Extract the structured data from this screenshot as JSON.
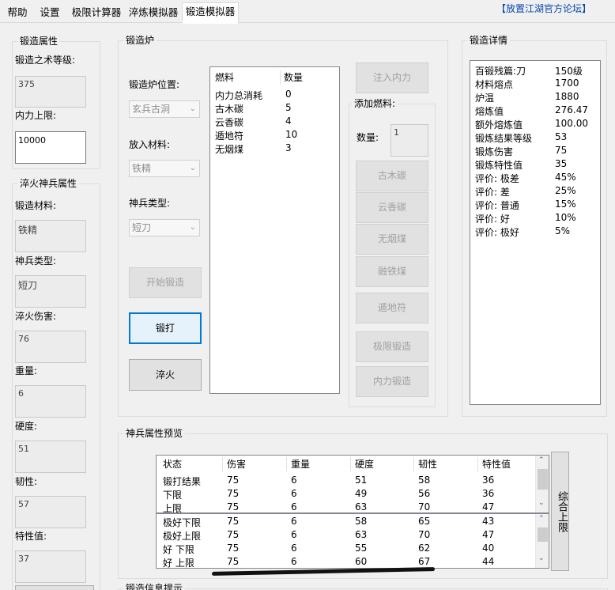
{
  "tabs": [
    "帮助",
    "设置",
    "极限计算器",
    "淬炼模拟器",
    "锻造模拟器"
  ],
  "forum_link": "【放置江湖官方论坛】",
  "forge_attr": {
    "title": "锻造属性",
    "level_label": "锻造之术等级:",
    "level_value": "375",
    "neili_label": "内力上限:",
    "neili_value": "10000"
  },
  "temper_attr": {
    "title": "淬火神兵属性",
    "material_label": "锻造材料:",
    "material_value": "铁精",
    "type_label": "神兵类型:",
    "type_value": "短刀",
    "damage_label": "淬火伤害:",
    "damage_value": "76",
    "weight_label": "重量:",
    "weight_value": "6",
    "hardness_label": "硬度:",
    "hardness_value": "51",
    "toughness_label": "韧性:",
    "toughness_value": "57",
    "trait_label": "特性值:",
    "trait_value": "37"
  },
  "furnace": {
    "title": "锻造炉",
    "location_label": "锻造炉位置:",
    "location_value": "玄兵古洞",
    "material_label": "放入材料:",
    "material_value": "铁精",
    "weapon_label": "神兵类型:",
    "weapon_value": "短刀",
    "start_button": "开始锻造",
    "forge_button": "锻打",
    "temper_button": "淬火",
    "fuel_headers": [
      "燃料",
      "数量"
    ],
    "fuel_rows": [
      [
        "内力总消耗",
        "0"
      ],
      [
        "古木碳",
        "5"
      ],
      [
        "云香碳",
        "4"
      ],
      [
        "遁地符",
        "10"
      ],
      [
        "无烟煤",
        "3"
      ]
    ],
    "inject_button": "注入内力",
    "add_fuel_title": "添加燃料:",
    "qty_label": "数量:",
    "qty_value": "1",
    "fuel_buttons": [
      "古木碳",
      "云香碳",
      "无烟煤",
      "融铁煤",
      "遁地符",
      "极限锻造",
      "内力锻造"
    ]
  },
  "details": {
    "title": "锻造详情",
    "rows": [
      [
        "百锻残篇:刀",
        "150级"
      ],
      [
        "材料熔点",
        "1700"
      ],
      [
        "炉温",
        "1880"
      ],
      [
        "熔炼值",
        "276.47"
      ],
      [
        "额外熔炼值",
        "100.00"
      ],
      [
        "锻炼结果等级",
        "53"
      ],
      [
        "锻炼伤害",
        "75"
      ],
      [
        "锻炼特性值",
        "35"
      ],
      [
        "评价: 极差",
        "45%"
      ],
      [
        "评价:  差",
        "25%"
      ],
      [
        "评价: 普通",
        "15%"
      ],
      [
        "评价:  好",
        "10%"
      ],
      [
        "评价: 极好",
        "5%"
      ]
    ]
  },
  "preview": {
    "title": "神兵属性预览",
    "headers": [
      "状态",
      "伤害",
      "重量",
      "硬度",
      "韧性",
      "特性值"
    ],
    "top_rows": [
      [
        "锻打结果",
        "75",
        "6",
        "51",
        "58",
        "36"
      ],
      [
        "下限",
        "75",
        "6",
        "49",
        "56",
        "36"
      ],
      [
        "上限",
        "75",
        "6",
        "63",
        "70",
        "47"
      ]
    ],
    "bottom_rows": [
      [
        "极好下限",
        "75",
        "6",
        "58",
        "65",
        "43"
      ],
      [
        "极好上限",
        "75",
        "6",
        "63",
        "70",
        "47"
      ],
      [
        "好 下限",
        "75",
        "6",
        "55",
        "62",
        "40"
      ],
      [
        "好 上限",
        "75",
        "6",
        "60",
        "67",
        "44"
      ]
    ],
    "side_button": "综合上限"
  },
  "hint_title": "锻造信息提示"
}
